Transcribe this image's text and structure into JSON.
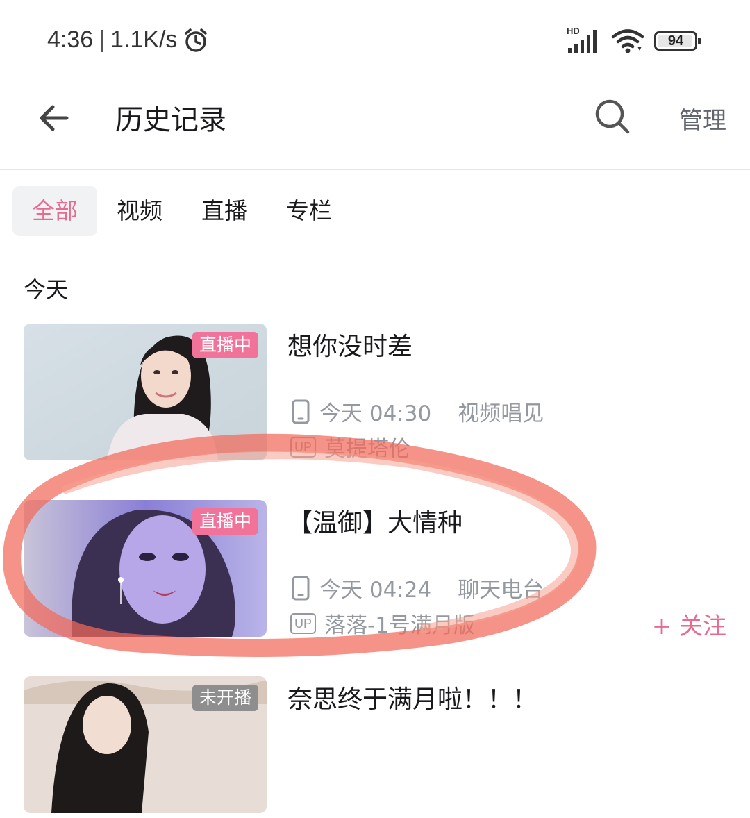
{
  "status_bar": {
    "time": "4:36",
    "network_speed": "1.1K/s",
    "signal_label": "HD",
    "battery": "94",
    "battery_level": 0.94
  },
  "header": {
    "title": "历史记录",
    "manage_label": "管理"
  },
  "tabs": [
    {
      "label": "全部",
      "active": true
    },
    {
      "label": "视频",
      "active": false
    },
    {
      "label": "直播",
      "active": false
    },
    {
      "label": "专栏",
      "active": false
    }
  ],
  "section_label": "今天",
  "items": [
    {
      "title": "想你没时差",
      "badge": "直播中",
      "time": "今天 04:30",
      "category": "视频唱见",
      "up_badge": "UP",
      "uploader": "莫提塔伦"
    },
    {
      "title": "【温御】大情种",
      "badge": "直播中",
      "time": "今天 04:24",
      "category": "聊天电台",
      "up_badge": "UP",
      "uploader": "落落-1号满月版",
      "follow_label": "+ 关注"
    },
    {
      "title": "奈思终于满月啦！！！",
      "badge": "未开播"
    }
  ],
  "colors": {
    "accent_pink": "#e66b8f",
    "live_badge": "#f1739a",
    "annotation_circle": "#f26a5a"
  }
}
